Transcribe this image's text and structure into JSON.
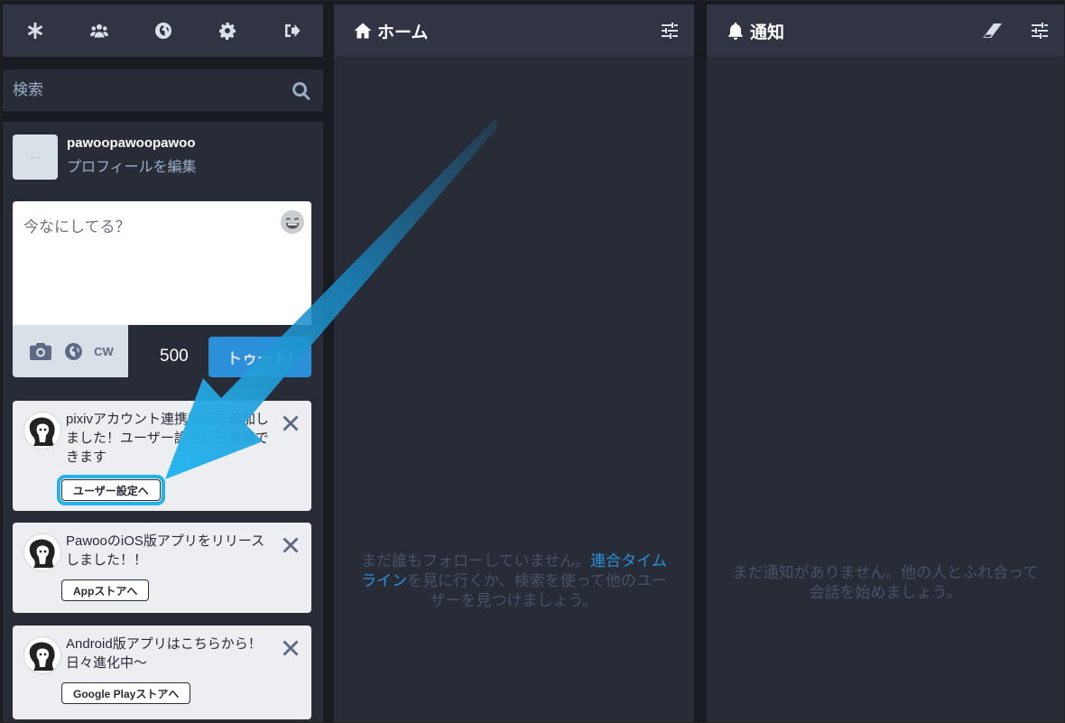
{
  "nav": {
    "items": [
      {
        "name": "getting-started-icon"
      },
      {
        "name": "local-timeline-icon"
      },
      {
        "name": "federated-timeline-icon"
      },
      {
        "name": "preferences-icon"
      },
      {
        "name": "logout-icon"
      }
    ]
  },
  "search": {
    "placeholder": "検索"
  },
  "account": {
    "username": "pawoopawoopawoo",
    "edit_profile": "プロフィールを編集",
    "avatar_alt": "ｰ ｰ"
  },
  "compose": {
    "placeholder": "今なにしてる？",
    "cw_label": "CW",
    "char_count": "500",
    "toot_label": "トゥート!"
  },
  "announcements": [
    {
      "text": "pixivアカウント連携機能を追加しました！ユーザー設定から連携できます",
      "button": "ユーザー設定へ"
    },
    {
      "text": "PawooのiOS版アプリをリリースしました！！",
      "button": "Appストアへ"
    },
    {
      "text": "Android版アプリはこちらから！日々進化中〜",
      "button": "Google Playストアへ"
    }
  ],
  "columns": {
    "home": {
      "title": "ホーム",
      "empty_prefix": "まだ誰もフォローしていません。",
      "empty_link": "連合タイムライン",
      "empty_suffix": "を見に行くか、検索を使って他のユーザーを見つけましょう。"
    },
    "notifications": {
      "title": "通知",
      "empty": "まだ通知がありません。他の人とふれ合って会話を始めましょう。"
    }
  },
  "colors": {
    "accent": "#2b90d9",
    "highlight": "#25b2e6",
    "panel": "#282c37",
    "header": "#313543"
  }
}
